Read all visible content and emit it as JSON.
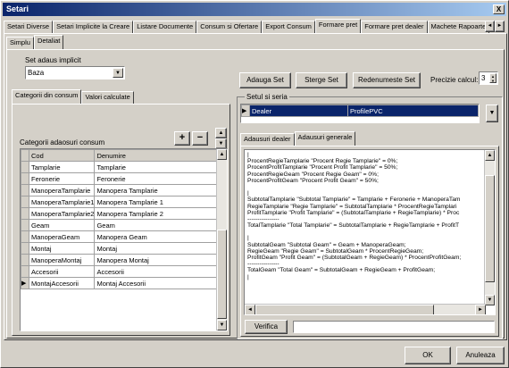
{
  "window": {
    "title": "Setari",
    "close_glyph": "X"
  },
  "top_tabs": [
    "Setari Diverse",
    "Setari Implicite la Creare",
    "Listare Documente",
    "Consum si Ofertare",
    "Export Consum",
    "Formare pret",
    "Formare pret dealer",
    "Machete Rapoarte"
  ],
  "top_tabs_active": "Formare pret",
  "tab_nav": {
    "left": "◄",
    "right": "►"
  },
  "sub_tabs": [
    "Simplu",
    "Detaliat"
  ],
  "sub_tabs_active": "Detaliat",
  "set_adaus": {
    "label": "Set adaus implicit",
    "value": "Baza",
    "arrow": "▼"
  },
  "left_tabs": [
    "Categorii din consum",
    "Valori calculate"
  ],
  "left_tabs_active": "Categorii din consum",
  "categorii": {
    "label": "Categorii adaosuri consum",
    "add": "+",
    "remove": "−",
    "columns": [
      "Cod",
      "Denumire"
    ],
    "rows": [
      {
        "cod": "Tamplarie",
        "den": "Tamplarie"
      },
      {
        "cod": "Feronerie",
        "den": "Feronerie"
      },
      {
        "cod": "ManoperaTamplarie",
        "den": "Manopera Tamplarie"
      },
      {
        "cod": "ManoperaTamplarie1",
        "den": "Manopera Tamplarie 1"
      },
      {
        "cod": "ManoperaTamplarie2",
        "den": "Manopera Tamplarie 2"
      },
      {
        "cod": "Geam",
        "den": "Geam"
      },
      {
        "cod": "ManoperaGeam",
        "den": "Manopera Geam"
      },
      {
        "cod": "Montaj",
        "den": "Montaj"
      },
      {
        "cod": "ManoperaMontaj",
        "den": "Manopera Montaj"
      },
      {
        "cod": "Accesorii",
        "den": "Accesorii"
      },
      {
        "cod": "MontajAccesorii",
        "den": "Montaj Accesorii"
      }
    ],
    "selected_index": 10
  },
  "toolbar": {
    "adauga": "Adauga Set",
    "sterge": "Sterge Set",
    "redenumeste": "Redenumeste Set",
    "precizie_label": "Precizie calcul:",
    "precizie_value": "3"
  },
  "setul": {
    "label": "Setul si seria",
    "set": "Dealer",
    "serie": "ProfilePVC"
  },
  "right_tabs": [
    "Adausuri dealer",
    "Adausuri generale"
  ],
  "right_tabs_active": "Adausuri generale",
  "code_lines": [
    "|",
    "ProcentRegieTamplarie \"Procent Regie Tamplarie\" = 0%;",
    "ProcentProfitTamplarie \"Procent Profit Tamplarie\" = 50%;",
    "ProcentRegieGeam \"Procent Regie Geam\" = 0%;",
    "ProcentProfitGeam \"Procent Profit Geam\" = 50%;",
    "",
    "|",
    "SubtotalTamplarie \"Subtotal Tamplarie\" = Tamplarie + Feronerie + ManoperaTam",
    "RegieTamplarie \"Regie Tamplarie\" = SubtotalTamplarie * ProcentRegieTamplari",
    "ProfitTamplarie \"Profit Tamplarie\" = (SubtotalTamplarie + RegieTamplarie) * Proc",
    "----------------",
    "TotalTamplarie \"Total Tamplarie\" = SubtotalTamplarie + RegieTamplarie + ProfitT",
    "",
    "|",
    "SubtotalGeam \"Subtotal Geam\" = Geam + ManoperaGeam;",
    "RegieGeam \"Regie Geam\" = SubtotalGeam * ProcentRegieGeam;",
    "ProfitGeam \"Profit Geam\" = (SubtotalGeam + RegieGeam) * ProcentProfitGeam;",
    "----------------",
    "TotalGeam \"Total Geam\" = SubtotalGeam + RegieGeam + ProfitGeam;",
    "|"
  ],
  "verifica": "Verifica",
  "footer": {
    "ok": "OK",
    "anuleaza": "Anuleaza"
  }
}
